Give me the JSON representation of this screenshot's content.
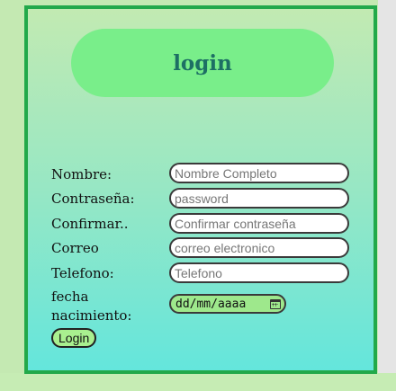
{
  "header": {
    "title": "login"
  },
  "form": {
    "fields": [
      {
        "label": "Nombre:",
        "placeholder": "Nombre Completo"
      },
      {
        "label": "Contraseña:",
        "placeholder": "password"
      },
      {
        "label": "Confirmar..",
        "placeholder": "Confirmar contraseña"
      },
      {
        "label": "Correo",
        "placeholder": "correo electronico"
      },
      {
        "label": "Telefono:",
        "placeholder": "Telefono"
      }
    ],
    "birthdate": {
      "label_line1": "fecha",
      "label_line2": "nacimiento:",
      "value": "dd/mm/aaaa",
      "icon": "calendar-icon"
    },
    "submit_label": "Login"
  },
  "colors": {
    "border": "#22a94a",
    "title_pill": "#79ee8a",
    "title_text": "#1d6f64",
    "gradient_top": "#c2eab2",
    "gradient_bottom": "#64e6dc",
    "button": "#a9f08f"
  }
}
